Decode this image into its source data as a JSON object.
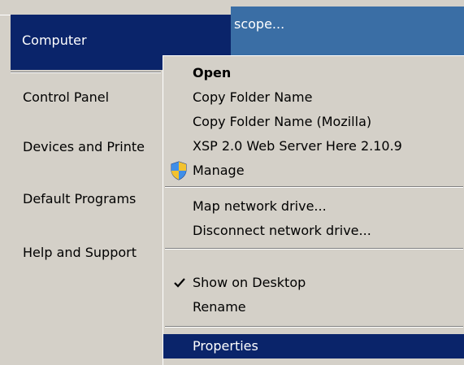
{
  "backdrop": {
    "fragment": "scope..."
  },
  "start_menu": {
    "computer_label": "Computer",
    "items": [
      {
        "label": "Control Panel"
      },
      {
        "label": "Devices and Printe"
      },
      {
        "label": "Default Programs"
      },
      {
        "label": "Help and Support"
      }
    ]
  },
  "context_menu": {
    "items": [
      {
        "label": "Open"
      },
      {
        "label": "Copy Folder Name"
      },
      {
        "label": "Copy Folder Name (Mozilla)"
      },
      {
        "label": "XSP 2.0 Web Server Here 2.10.9"
      },
      {
        "label": "Manage"
      },
      {
        "label": "Map network drive..."
      },
      {
        "label": "Disconnect network drive..."
      },
      {
        "label": "Show on Desktop"
      },
      {
        "label": "Rename"
      },
      {
        "label": "Properties"
      }
    ]
  },
  "colors": {
    "menu_bg": "#d4d0c8",
    "highlight": "#0a246a",
    "desktop_window": "#3a6ea5"
  }
}
